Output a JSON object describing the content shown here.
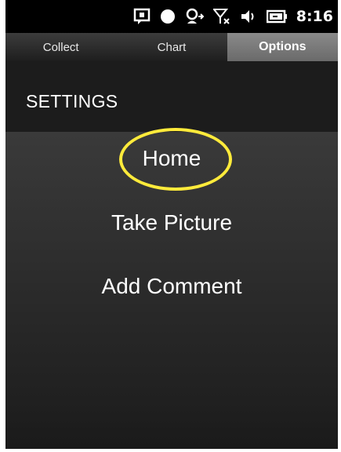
{
  "status_bar": {
    "time": "8:16",
    "icons": [
      "notification-icon",
      "record-icon",
      "phone-icon",
      "signal-icon",
      "volume-icon",
      "battery-icon"
    ]
  },
  "tabs": [
    {
      "label": "Collect",
      "active": false
    },
    {
      "label": "Chart",
      "active": false
    },
    {
      "label": "Options",
      "active": true
    }
  ],
  "header": {
    "title": "SETTINGS"
  },
  "menu": {
    "items": [
      {
        "label": "Home"
      },
      {
        "label": "Take Picture"
      },
      {
        "label": "Add Comment"
      }
    ],
    "highlighted_item": "Home"
  },
  "colors": {
    "highlight": "#ffeb3b"
  }
}
